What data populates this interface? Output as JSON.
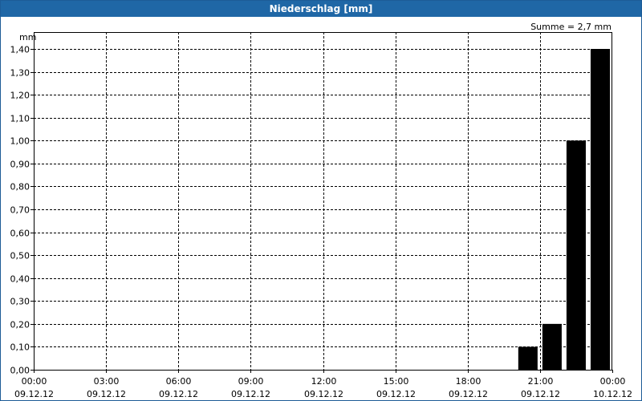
{
  "window": {
    "title": "Niederschlag [mm]"
  },
  "annotation": "Summe = 2,7 mm",
  "chart_data": {
    "type": "bar",
    "title": "Niederschlag [mm]",
    "ylabel": "mm",
    "xlabel": "",
    "ylim": [
      0,
      1.4
    ],
    "yticks": [
      "0,00",
      "0,10",
      "0,20",
      "0,30",
      "0,40",
      "0,50",
      "0,60",
      "0,70",
      "0,80",
      "0,90",
      "1,00",
      "1,10",
      "1,20",
      "1,30",
      "1,40"
    ],
    "xlim_hours": [
      0,
      24
    ],
    "xticks": [
      {
        "time": "00:00",
        "date": "09.12.12"
      },
      {
        "time": "03:00",
        "date": "09.12.12"
      },
      {
        "time": "06:00",
        "date": "09.12.12"
      },
      {
        "time": "09:00",
        "date": "09.12.12"
      },
      {
        "time": "12:00",
        "date": "09.12.12"
      },
      {
        "time": "15:00",
        "date": "09.12.12"
      },
      {
        "time": "18:00",
        "date": "09.12.12"
      },
      {
        "time": "21:00",
        "date": "09.12.12"
      },
      {
        "time": "00:00",
        "date": "10.12.12"
      }
    ],
    "bars": [
      {
        "hour": 20.5,
        "value": 0.1
      },
      {
        "hour": 21.5,
        "value": 0.2
      },
      {
        "hour": 22.5,
        "value": 1.0
      },
      {
        "hour": 23.5,
        "value": 1.4
      }
    ],
    "grid": true,
    "colors": {
      "bar": "#000000",
      "titlebar": "#1f67a6"
    }
  }
}
